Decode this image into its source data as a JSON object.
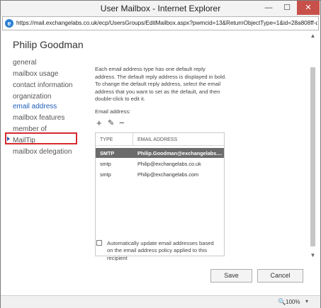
{
  "window": {
    "title": "User Mailbox - Internet Explorer",
    "minimize_glyph": "—",
    "maximize_glyph": "☐",
    "close_glyph": "✕"
  },
  "address_bar": {
    "url": "https://mail.exchangelabs.co.uk/ecp/UsersGroups/EditMailbox.aspx?pwmcid=13&ReturnObjectType=1&id=28a808ff-d08b-4e"
  },
  "user": {
    "display_name": "Philip Goodman"
  },
  "nav": {
    "items": [
      "general",
      "mailbox usage",
      "contact information",
      "organization",
      "email address",
      "mailbox features",
      "member of",
      "MailTip",
      "mailbox delegation"
    ],
    "active_index": 4
  },
  "email_section": {
    "description": "Each email address type has one default reply address. The default reply address is displayed in bold. To change the default reply address, select the email address that you want to set as the default, and then double-click to edit it.",
    "label": "Email address:",
    "toolbar": {
      "add": "+",
      "edit": "✎",
      "remove": "−"
    },
    "columns": [
      "TYPE",
      "EMAIL ADDRESS"
    ],
    "rows": [
      {
        "type": "SMTP",
        "email": "Philip.Goodman@exchangelabs....",
        "selected": true
      },
      {
        "type": "smtp",
        "email": "Philip@exchangelabs.co.uk",
        "selected": false
      },
      {
        "type": "smtp",
        "email": "Philip@exchangelabs.com",
        "selected": false
      }
    ],
    "auto_update_label": "Automatically update email addresses based on the email address policy applied to this recipient",
    "auto_update_checked": false
  },
  "buttons": {
    "save": "Save",
    "cancel": "Cancel"
  },
  "status_bar": {
    "zoom": "100%",
    "zoom_icon": "🔍",
    "caret": "▾"
  },
  "scrollbar": {
    "up": "▲",
    "down": "▼"
  },
  "colors": {
    "accent": "#1f5fb8",
    "selection_row": "#6b6b6b",
    "highlight_box": "#d6292f",
    "close_button": "#c7514a"
  }
}
